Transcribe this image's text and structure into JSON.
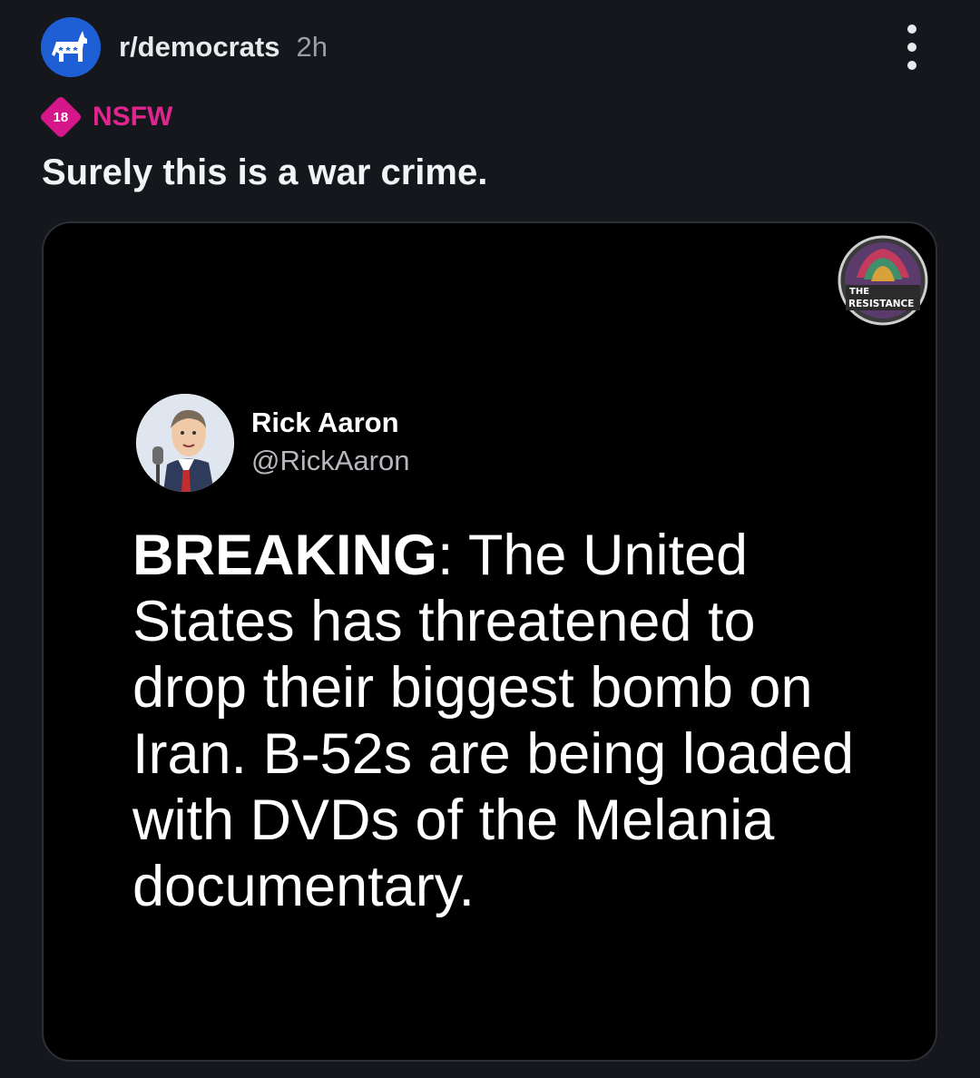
{
  "post": {
    "subreddit": "r/democrats",
    "age": "2h",
    "nsfw_badge": "18",
    "nsfw_label": "NSFW",
    "title": "Surely this is a war crime."
  },
  "media": {
    "logo_text_line1": "THE",
    "logo_text_line2": "RESISTANCE",
    "tweet": {
      "author_name": "Rick Aaron",
      "handle": "@RickAaron",
      "lead": "BREAKING",
      "body": ": The United States has threatened to drop their biggest bomb on Iran. B-52s are being loaded with DVDs of the Melania documentary."
    }
  },
  "icons": {
    "subreddit_avatar": "donkey-icon",
    "menu": "more-vertical-icon",
    "nsfw": "nsfw-18-icon"
  },
  "colors": {
    "background": "#15171c",
    "subreddit_avatar_bg": "#1f5fd6",
    "nsfw": "#d6178a",
    "media_bg": "#000000"
  }
}
